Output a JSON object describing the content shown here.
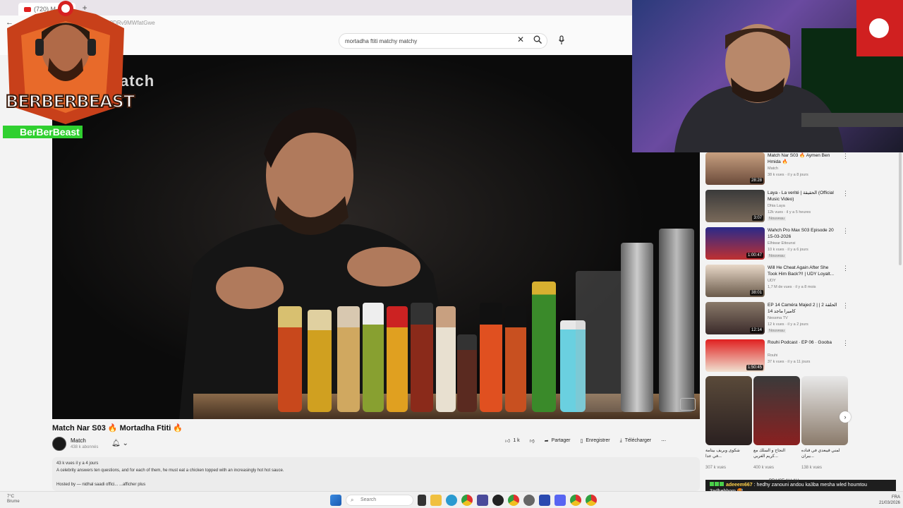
{
  "browser": {
    "tab_title": "(720) M",
    "address": "...?DRv9MWfatGwe"
  },
  "search": {
    "query": "mortadha ftiti matchy matchy"
  },
  "video": {
    "watermark": "atch",
    "title": "Match Nar S03 🔥 Mortadha Ftiti 🔥",
    "channel": "Match",
    "subscribers": "438 k abonnés",
    "likes": "1 k",
    "share_label": "Partager",
    "save_label": "Enregistrer",
    "download_label": "Télécharger",
    "more_label": "⋯",
    "views_line": "43 k vues  il y a 4 jours",
    "description": "A celebrity answers ten questions, and for each of them, he must eat a chicken topped with an increasingly hot hot sauce.",
    "hosted_by": "Hosted by",
    "hosted_names": "nidhal saadi offici...",
    "show_more": "...afficher plus"
  },
  "overlay": {
    "logo_text": "BERBERBEAST",
    "handle": "BerBerBeast"
  },
  "recommended": [
    {
      "title": "Match Nar S03 🔥 Aymen Ben Hmida 🔥",
      "channel": "Match",
      "meta": "38 k vues · il y a 8 jours",
      "badge": "",
      "duration": "28:28"
    },
    {
      "title": "Laya - La verité | الحقيقة (Official Music Video)",
      "channel": "Dhia Laya",
      "meta": "12k vues · il y a 5 heures",
      "badge": "Nouveau",
      "duration": "3:07"
    },
    {
      "title": "Wahch Pro Max S03 Episode 20 15-03-2026",
      "channel": "Elhiwar Ettounsi",
      "meta": "10 k vues · il y a 6 jours",
      "badge": "Nouveau",
      "duration": "1:00:47"
    },
    {
      "title": "Will He Cheat Again After She Took Him Back?!! | UDY Loyalt...",
      "channel": "UDY",
      "meta": "1,7 M de vues · il y a 8 mois",
      "badge": "",
      "duration": "38:01"
    },
    {
      "title": "EP 14 Caméra Majed 2 | الحلقة 2 | كاميرا ماجد 14",
      "channel": "Nessma TV",
      "meta": "12 k vues · il y a 2 jours",
      "badge": "Nouveau",
      "duration": "12:14"
    },
    {
      "title": "Rouhi Podcast · EP 06 · Gooba",
      "channel": "Rouhi",
      "meta": "37 k vues · il y a 11 jours",
      "badge": "",
      "duration": "1:50:45"
    }
  ],
  "shorts": [
    {
      "title": "شكوى وبريف بيتامة في عدا...",
      "views": "307 k vues"
    },
    {
      "title": "النجاح و السلك مع كريم الغربي...",
      "views": "400 k vues"
    },
    {
      "title": "لمني قيبعدي في قناده يبران...",
      "views": "138 k vues"
    }
  ],
  "chat": {
    "next_label": "PRAISE ALLAH",
    "user": "adeeem667",
    "message": ": hedhy zanouni andou ka3ba mesha wled houmtou 3adhebhom 🥵"
  },
  "taskbar": {
    "weather_temp": "7°C",
    "weather_desc": "Brume",
    "search_placeholder": "Search",
    "lang": "FRA",
    "date": "21/03/2026"
  },
  "colors": {
    "accent": "#e02020",
    "handle_bg": "#30d030",
    "chat_user": "#ffd24a"
  }
}
